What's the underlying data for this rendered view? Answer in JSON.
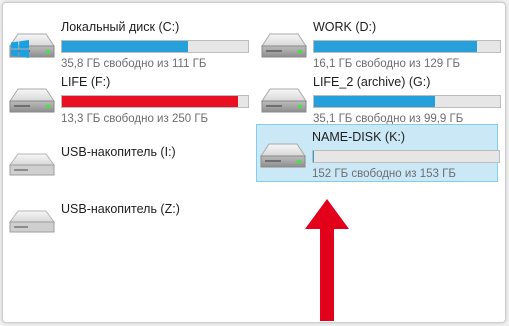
{
  "colors": {
    "bar_normal": "#26a0da",
    "bar_full": "#e81123",
    "selection_bg": "#cbe8f6",
    "arrow": "#e2001a"
  },
  "drives": [
    {
      "name": "Локальный диск (C:)",
      "free_text": "35,8 ГБ свободно из 111 ГБ",
      "used_fraction": 0.68,
      "bar_color": "#26a0da",
      "has_windows_logo": true,
      "icon": "hard-drive-icon"
    },
    {
      "name": "WORK (D:)",
      "free_text": "16,1 ГБ свободно из 129 ГБ",
      "used_fraction": 0.875,
      "bar_color": "#26a0da",
      "icon": "hard-drive-icon"
    },
    {
      "name": "LIFE (F:)",
      "free_text": "13,3 ГБ свободно из 250 ГБ",
      "used_fraction": 0.947,
      "bar_color": "#e81123",
      "icon": "hard-drive-icon"
    },
    {
      "name": "LIFE_2 (archive) (G:)",
      "free_text": "35,1 ГБ свободно из 99,9 ГБ",
      "used_fraction": 0.65,
      "bar_color": "#26a0da",
      "icon": "hard-drive-icon"
    },
    {
      "name": "NAME-DISK (K:)",
      "free_text": "152 ГБ свободно из 153 ГБ",
      "used_fraction": 0.007,
      "bar_color": "#26a0da",
      "selected": true,
      "icon": "hard-drive-icon"
    },
    {
      "name": "USB-накопитель (I:)",
      "icon": "usb-drive-icon"
    },
    {
      "name": "USB-накопитель (Z:)",
      "icon": "usb-drive-icon"
    }
  ]
}
